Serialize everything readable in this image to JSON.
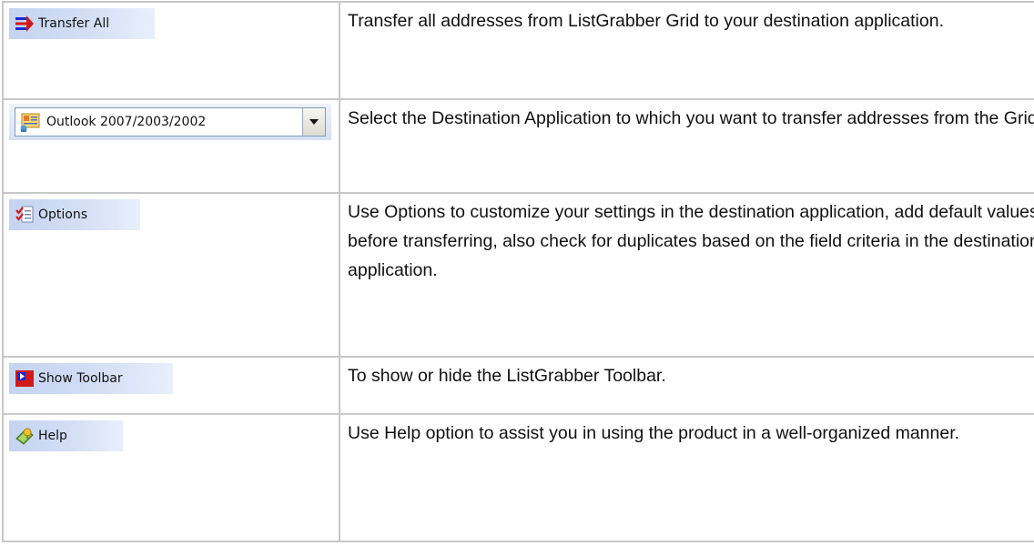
{
  "rows": [
    {
      "button_label": "Transfer All",
      "icon": "transfer-arrows-icon",
      "description": "Transfer all addresses from ListGrabber Grid to your destination application."
    },
    {
      "button_label": "Outlook 2007/2003/2002",
      "icon": "outlook-contact-card-icon",
      "description": "Select the Destination Application to which you want to transfer addresses from the Grid."
    },
    {
      "button_label": "Options",
      "icon": "options-checklist-icon",
      "description": "Use Options to customize your settings in the destination application, add default values before transferring, also check for duplicates based on the field criteria in the destination application."
    },
    {
      "button_label": "Show Toolbar",
      "icon": "show-toolbar-icon",
      "description": "To show or hide the ListGrabber Toolbar."
    },
    {
      "button_label": "Help",
      "icon": "help-book-icon",
      "description": "Use Help option to assist you in using the product in a well-organized manner."
    }
  ]
}
